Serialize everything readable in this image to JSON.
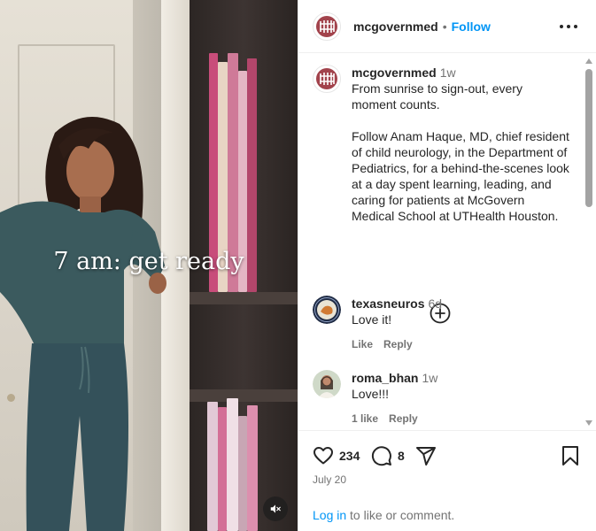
{
  "video": {
    "caption": "7 am: get ready",
    "mute_icon": "speaker-muted-icon"
  },
  "header": {
    "username": "mcgovernmed",
    "separator": "•",
    "follow_label": "Follow",
    "more_icon": "more-horizontal-icon"
  },
  "post": {
    "username": "mcgovernmed",
    "time": "1w",
    "text": "From sunrise to sign-out, every moment counts.\n\nFollow Anam Haque, MD, chief resident of child neurology, in the Department of Pediatrics, for a behind-the-scenes look at a day spent learning, leading, and caring for patients at McGovern Medical School at UTHealth Houston."
  },
  "comments": [
    {
      "username": "texasneuros",
      "time": "6d",
      "text": "Love it!",
      "likes_label": "Like",
      "reply_label": "Reply"
    },
    {
      "username": "roma_bhan",
      "time": "1w",
      "text": "Love!!!",
      "likes_label": "1 like",
      "reply_label": "Reply"
    }
  ],
  "actions": {
    "like_count": "234",
    "comment_count": "8",
    "icons": [
      "heart-icon",
      "comment-icon",
      "share-icon",
      "bookmark-icon"
    ]
  },
  "date": "July 20",
  "login": {
    "link": "Log in",
    "rest": " to like or comment."
  },
  "colors": {
    "accent": "#0095f6",
    "muted_text": "#737373",
    "text": "#262626"
  }
}
